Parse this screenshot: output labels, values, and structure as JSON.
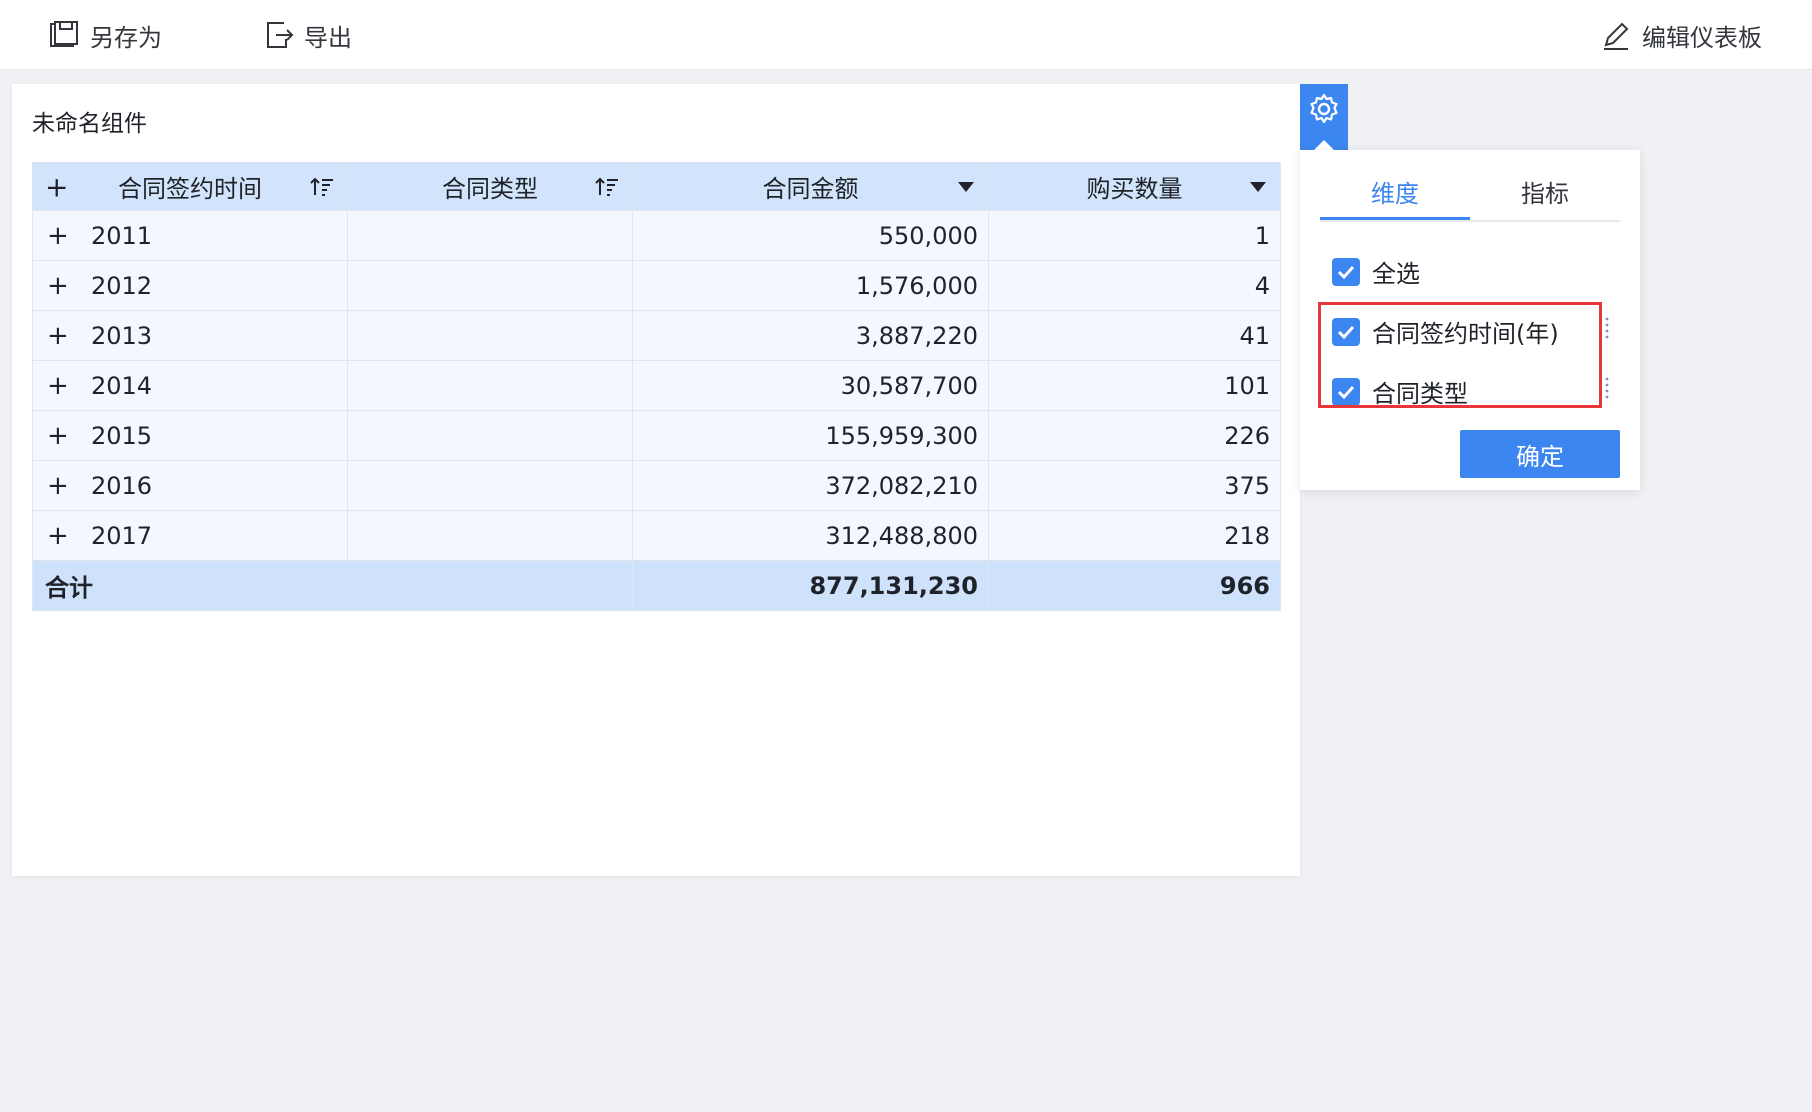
{
  "toolbar": {
    "save_as_label": "另存为",
    "export_label": "导出",
    "edit_dashboard_label": "编辑仪表板"
  },
  "widget": {
    "title": "未命名组件",
    "table": {
      "headers": [
        "合同签约时间",
        "合同类型",
        "合同金额",
        "购买数量"
      ],
      "rows": [
        {
          "year": "2011",
          "type": "",
          "amount": "550,000",
          "quantity": "1"
        },
        {
          "year": "2012",
          "type": "",
          "amount": "1,576,000",
          "quantity": "4"
        },
        {
          "year": "2013",
          "type": "",
          "amount": "3,887,220",
          "quantity": "41"
        },
        {
          "year": "2014",
          "type": "",
          "amount": "30,587,700",
          "quantity": "101"
        },
        {
          "year": "2015",
          "type": "",
          "amount": "155,959,300",
          "quantity": "226"
        },
        {
          "year": "2016",
          "type": "",
          "amount": "372,082,210",
          "quantity": "375"
        },
        {
          "year": "2017",
          "type": "",
          "amount": "312,488,800",
          "quantity": "218"
        }
      ],
      "total": {
        "label": "合计",
        "amount": "877,131,230",
        "quantity": "966"
      }
    }
  },
  "popover": {
    "tabs": [
      "维度",
      "指标"
    ],
    "active_tab": "维度",
    "select_all_label": "全选",
    "dimensions": [
      {
        "label": "合同签约时间(年)",
        "checked": true
      },
      {
        "label": "合同类型",
        "checked": true
      }
    ],
    "confirm_label": "确定"
  },
  "colors": {
    "accent": "#3b86f0",
    "header_bg": "#d2e4fb",
    "highlight": "#e8373a"
  }
}
